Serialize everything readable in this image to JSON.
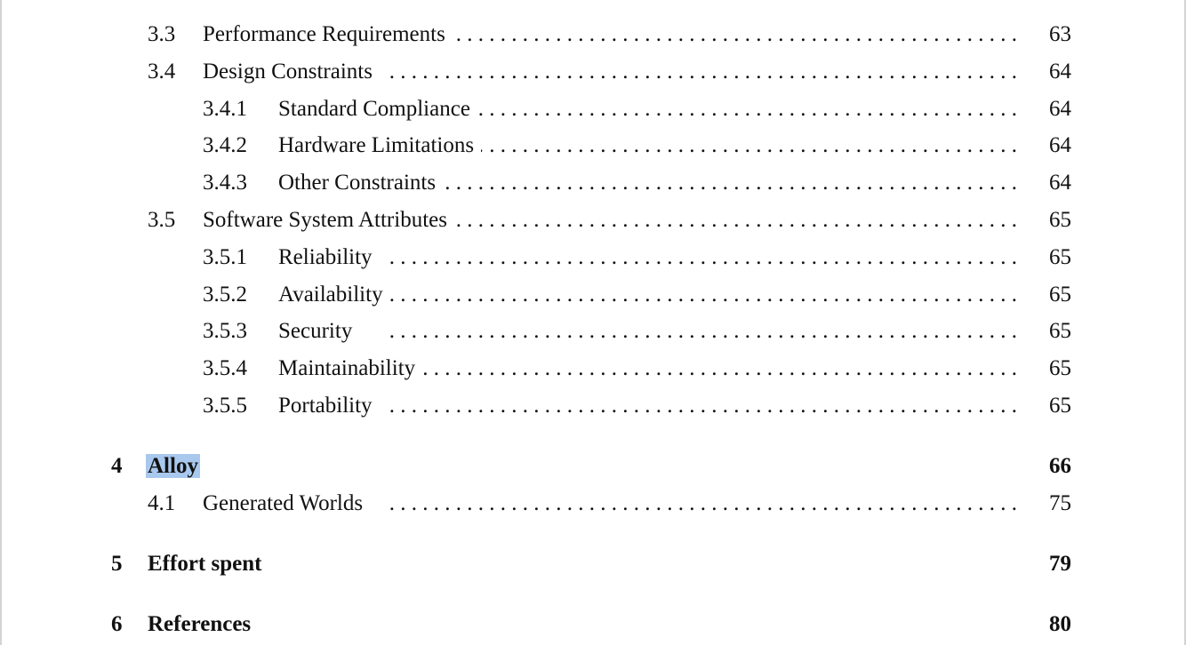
{
  "entries": [
    {
      "number": "3.3",
      "title": "Performance Requirements",
      "page": "63",
      "level": 1
    },
    {
      "number": "3.4",
      "title": "Design Constraints",
      "page": "64",
      "level": 1
    },
    {
      "number": "3.4.1",
      "title": "Standard Compliance",
      "page": "64",
      "level": 2
    },
    {
      "number": "3.4.2",
      "title": "Hardware Limitations",
      "page": "64",
      "level": 2
    },
    {
      "number": "3.4.3",
      "title": "Other Constraints",
      "page": "64",
      "level": 2
    },
    {
      "number": "3.5",
      "title": "Software System Attributes",
      "page": "65",
      "level": 1
    },
    {
      "number": "3.5.1",
      "title": "Reliability",
      "page": "65",
      "level": 2
    },
    {
      "number": "3.5.2",
      "title": "Availability",
      "page": "65",
      "level": 2
    },
    {
      "number": "3.5.3",
      "title": "Security",
      "page": "65",
      "level": 2
    },
    {
      "number": "3.5.4",
      "title": "Maintainability",
      "page": "65",
      "level": 2
    },
    {
      "number": "3.5.5",
      "title": "Portability",
      "page": "65",
      "level": 2
    },
    {
      "number": "4",
      "title": "Alloy",
      "page": "66",
      "level": 0,
      "selected": true
    },
    {
      "number": "4.1",
      "title": "Generated Worlds",
      "page": "75",
      "level": 1
    },
    {
      "number": "5",
      "title": "Effort spent",
      "page": "79",
      "level": 0
    },
    {
      "number": "6",
      "title": "References",
      "page": "80",
      "level": 0
    }
  ],
  "dot_leader": ". . . . . . . . . . . . . . . . . . . . . . . . . . . . . . . . . . . . . . . . . . . . . . . . . . . . . . . . .",
  "selection_color": "#a9c8ee"
}
